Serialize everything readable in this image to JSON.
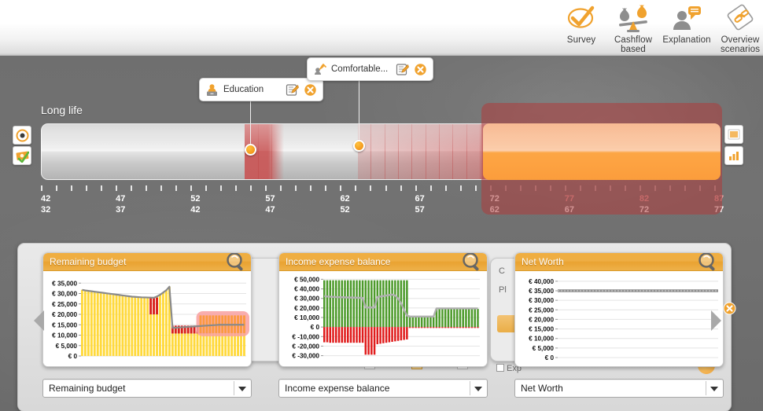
{
  "header": {
    "buttons": [
      {
        "label": "Survey",
        "icon": "checkmark-survey-icon"
      },
      {
        "label": "Cashflow\nbased",
        "label_line1": "Cashflow",
        "label_line2": "based",
        "icon": "money-bags-balance-icon"
      },
      {
        "label": "Explanation",
        "icon": "person-speech-bubble-icon"
      },
      {
        "label": "Overview\nscenarios",
        "label_line1": "Overview",
        "label_line2": "scenarios",
        "icon": "scenarios-diamond-icon"
      }
    ]
  },
  "timeline": {
    "title": "Long life",
    "left_tools": [
      {
        "name": "target-icon",
        "label": "Target"
      },
      {
        "name": "money-check-icon",
        "label": "Money"
      }
    ],
    "right_tools": [
      {
        "name": "list-view-icon",
        "label": "List view"
      },
      {
        "name": "bar-chart-icon",
        "label": "Chart view"
      }
    ],
    "axis_top": [
      "42",
      "47",
      "52",
      "57",
      "62",
      "67",
      "72",
      "77",
      "82",
      "87"
    ],
    "axis_bottom": [
      "32",
      "37",
      "42",
      "47",
      "52",
      "57",
      "62",
      "67",
      "72",
      "77"
    ],
    "axis_top_red_from_index": 7,
    "events": [
      {
        "label": "Education",
        "icon": "education-person-icon",
        "edit_icon": "edit-pencil-icon",
        "delete_icon": "delete-circle-icon"
      },
      {
        "label": "Comfortable...",
        "icon": "comfortable-retirement-icon",
        "edit_icon": "edit-pencil-icon",
        "delete_icon": "delete-circle-icon"
      }
    ]
  },
  "carousel": {
    "close_icon": "close-circle-icon",
    "prev_icon": "arrow-left-icon",
    "next_icon": "arrow-right-icon",
    "panels": [
      {
        "title": "Remaining budget",
        "magnifier_icon": "magnifier-icon",
        "combo_value": "Remaining budget",
        "combo_arrow_icon": "chevron-down-icon"
      },
      {
        "title": "Income expense balance",
        "magnifier_icon": "magnifier-icon",
        "combo_value": "Income expense balance",
        "combo_arrow_icon": "chevron-down-icon"
      },
      {
        "title": "Net Worth",
        "magnifier_icon": "magnifier-icon",
        "combo_value": "Net Worth",
        "combo_arrow_icon": "chevron-down-icon"
      }
    ],
    "background_texts": {
      "c_label": "C",
      "pl_label": "Pl",
      "export_label": "Exp"
    }
  },
  "chart_data": [
    {
      "type": "area",
      "id": "remaining-budget",
      "title": "Remaining budget",
      "ylabel": "",
      "xlabel": "",
      "ytick_labels": [
        "€ 35,000",
        "€ 30,000",
        "€ 25,000",
        "€ 20,000",
        "€ 15,000",
        "€ 10,000",
        "€ 5,000",
        "€ 0"
      ],
      "ytick_values": [
        35000,
        30000,
        25000,
        20000,
        15000,
        10000,
        5000,
        0
      ],
      "ylim": [
        0,
        37000
      ],
      "grid": true,
      "legend": "none",
      "colors": {
        "positive": "#FFD93B",
        "negative": "#D81F1F",
        "line": "#8A8A8A",
        "highlight_fill": "#FB9A3F",
        "highlight_glow": "#F8A0A0"
      },
      "series": [
        {
          "name": "Remaining budget",
          "values": [
            31800,
            31500,
            31300,
            31100,
            30900,
            30700,
            30500,
            30300,
            30100,
            29900,
            29700,
            29500,
            29300,
            29100,
            28900,
            28700,
            28500,
            28400,
            28300,
            28200,
            28150,
            28100,
            28050,
            28000,
            28600,
            29400,
            30500,
            31600,
            33300,
            13500,
            13600,
            13700,
            13800,
            13900,
            14000,
            14100,
            14200,
            14300,
            14400,
            14500,
            14600,
            14700,
            14800,
            14900,
            15000,
            15000,
            15000,
            15000,
            15000,
            15000,
            15000,
            15000,
            15000
          ]
        }
      ],
      "negative_bars": {
        "indices": [
          22,
          23,
          24,
          29,
          30,
          31,
          32,
          33,
          34,
          35,
          36,
          37,
          38,
          39,
          40
        ],
        "note": "red segments drawn above the filled area"
      },
      "highlight_region": {
        "from_index": 38,
        "to_index": 53,
        "label": "selected scenario window"
      }
    },
    {
      "type": "bar",
      "id": "income-expense-balance",
      "title": "Income expense balance",
      "ylabel": "",
      "xlabel": "",
      "ytick_labels": [
        "€ 50,000",
        "€ 40,000",
        "€ 30,000",
        "€ 20,000",
        "€ 10,000",
        "€ 0",
        "€ -10,000",
        "€ -20,000",
        "€ -30,000"
      ],
      "ytick_values": [
        50000,
        40000,
        30000,
        20000,
        10000,
        0,
        -10000,
        -20000,
        -30000
      ],
      "ylim": [
        -32000,
        52000
      ],
      "grid": true,
      "legend": "none",
      "colors": {
        "income": "#4C9A2A",
        "expense": "#E01B1B",
        "line": "#AFAFAF"
      },
      "series": [
        {
          "name": "Income",
          "values": [
            49000,
            49000,
            49000,
            49000,
            49000,
            49000,
            49000,
            49000,
            49000,
            49000,
            49000,
            49000,
            49000,
            49000,
            49000,
            49000,
            49000,
            49000,
            49000,
            49000,
            49000,
            49000,
            49000,
            49000,
            49000,
            49000,
            49000,
            49000,
            49000,
            10500,
            10500,
            10500,
            10500,
            10500,
            10500,
            10500,
            10500,
            10500,
            19000,
            19000,
            19000,
            19000,
            19000,
            19000,
            19000,
            19000,
            19000,
            19000,
            19000,
            19000,
            19000,
            19000,
            19000
          ]
        },
        {
          "name": "Expense",
          "values": [
            -16000,
            -16000,
            -16500,
            -16500,
            -16500,
            -16500,
            -16500,
            -16500,
            -16500,
            -16500,
            -16500,
            -16500,
            -16500,
            -16500,
            -29000,
            -29000,
            -29000,
            -29000,
            -18000,
            -17500,
            -17000,
            -16500,
            -16000,
            -15500,
            -15000,
            -14500,
            -14000,
            -13500,
            -13000,
            -1000,
            -1000,
            -1000,
            -1000,
            -1000,
            -1000,
            -1000,
            -1000,
            -1000,
            -1000,
            -1000,
            -1000,
            -1000,
            -1000,
            -1000,
            -1000,
            -1000,
            -1000,
            -1000,
            -1000,
            -1000,
            -1000,
            -1000,
            -1000
          ]
        },
        {
          "name": "Balance line",
          "values": [
            32500,
            32000,
            31800,
            31600,
            31400,
            31300,
            31200,
            31100,
            31000,
            30900,
            30800,
            30700,
            30600,
            30500,
            20500,
            20500,
            20500,
            20500,
            31500,
            32000,
            32500,
            33000,
            33500,
            34000,
            33000,
            30000,
            25000,
            18000,
            12000,
            11000,
            11000,
            11000,
            11000,
            11000,
            11000,
            11000,
            11000,
            11000,
            19500,
            19500,
            19500,
            19500,
            19500,
            19500,
            19500,
            19500,
            19500,
            19500,
            19500,
            19500,
            19500,
            19500,
            19500
          ]
        }
      ]
    },
    {
      "type": "line",
      "id": "net-worth",
      "title": "Net Worth",
      "ylabel": "",
      "xlabel": "",
      "ytick_labels": [
        "€ 40,000",
        "€ 35,000",
        "€ 30,000",
        "€ 25,000",
        "€ 20,000",
        "€ 15,000",
        "€ 10,000",
        "€ 5,000",
        "€ 0"
      ],
      "ytick_values": [
        40000,
        35000,
        30000,
        25000,
        20000,
        15000,
        10000,
        5000,
        0
      ],
      "ylim": [
        0,
        42000
      ],
      "grid": true,
      "legend": "none",
      "colors": {
        "line": "#8F8F8F"
      },
      "series": [
        {
          "name": "Net Worth",
          "values": [
            35000,
            35000,
            35000,
            35000,
            35000,
            35000,
            35000,
            35000,
            35000,
            35000,
            35000,
            35000,
            35000,
            35000,
            35000,
            35000,
            35000,
            35000,
            35000,
            35000
          ]
        }
      ]
    }
  ]
}
